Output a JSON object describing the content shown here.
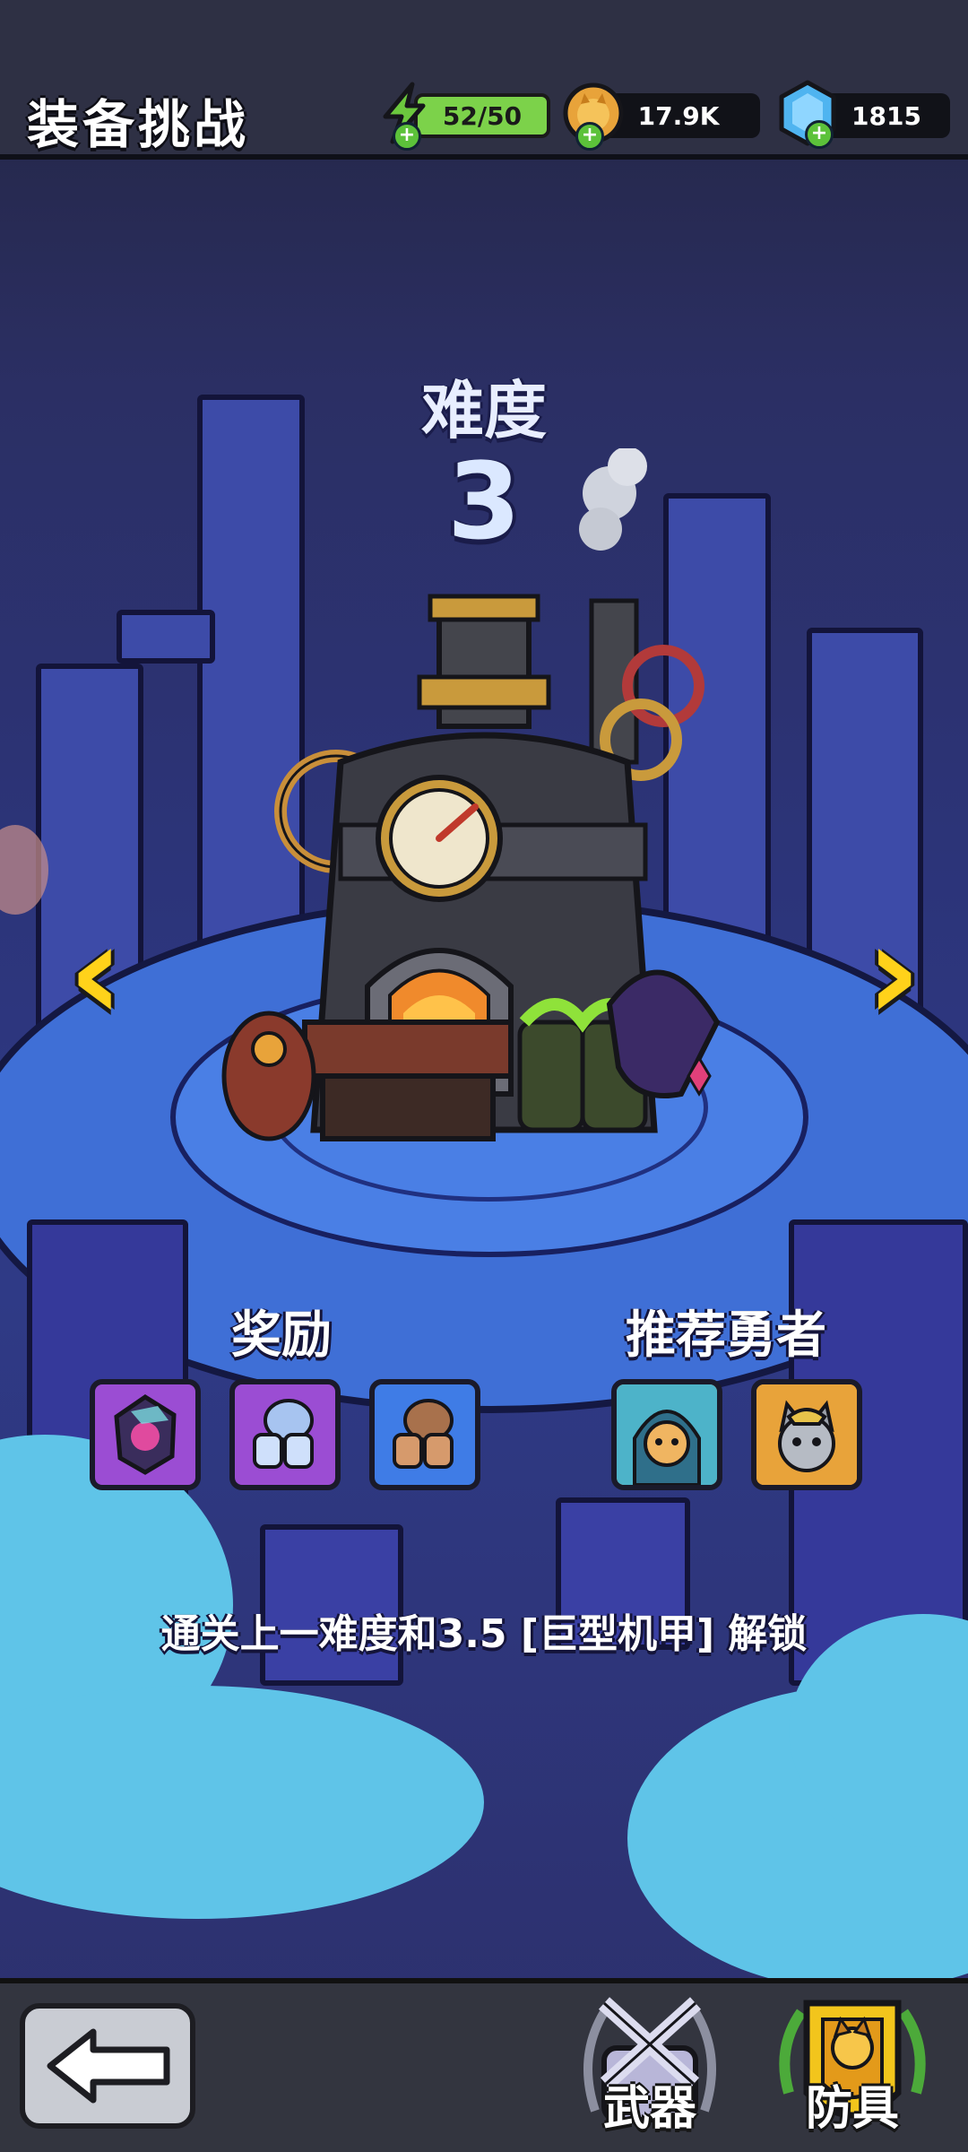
{
  "header": {
    "title": "装备挑战",
    "energy": "52/50",
    "gold": "17.9K",
    "gems": "1815"
  },
  "difficulty": {
    "label": "难度",
    "level": "3"
  },
  "rewards": {
    "label": "奖励",
    "items": [
      "magic-gem",
      "steel-boots",
      "leather-boots"
    ]
  },
  "heroes": {
    "label": "推荐勇者",
    "items": [
      "lion-knight-hero",
      "gray-cat-hero"
    ]
  },
  "unlock_text": "通关上一难度和3.5 [巨型机甲] 解锁",
  "bottom": {
    "weapons_label": "武器",
    "armor_label": "防具"
  },
  "colors": {
    "accent_yellow": "#ffd21a",
    "energy_green": "#7cd24a",
    "reward_purple": "#9b4dd3",
    "reward_blue": "#3f7ce6",
    "hero_orange": "#e8a33a"
  }
}
